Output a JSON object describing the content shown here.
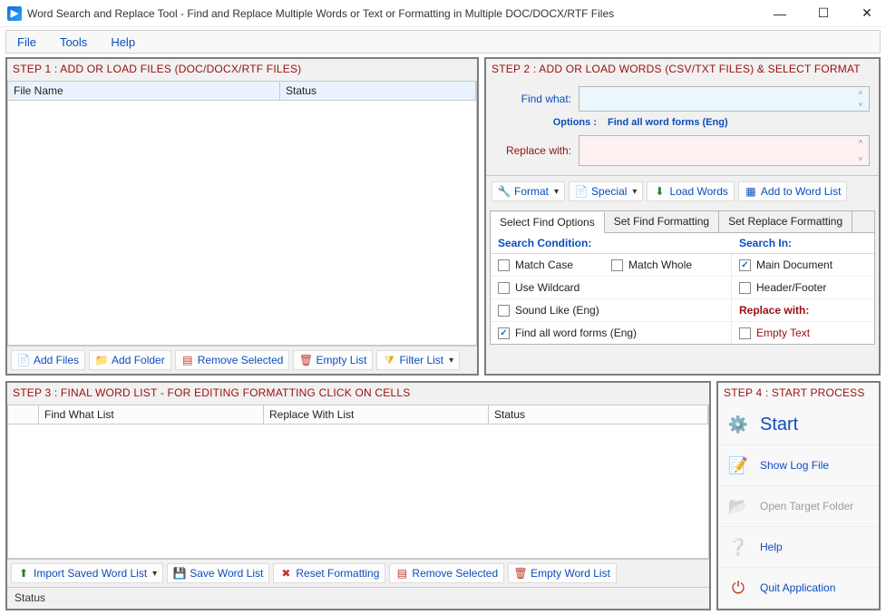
{
  "window": {
    "title": "Word Search and Replace Tool - Find and Replace Multiple Words or Text  or Formatting in Multiple DOC/DOCX/RTF Files"
  },
  "menu": {
    "file": "File",
    "tools": "Tools",
    "help": "Help"
  },
  "step1": {
    "title": "STEP 1 : ADD OR LOAD FILES (DOC/DOCX/RTF FILES)",
    "col_filename": "File Name",
    "col_status": "Status",
    "btn_add_files": "Add Files",
    "btn_add_folder": "Add Folder",
    "btn_remove_selected": "Remove Selected",
    "btn_empty_list": "Empty List",
    "btn_filter_list": "Filter List"
  },
  "step2": {
    "title": "STEP 2 : ADD OR LOAD WORDS (CSV/TXT FILES) & SELECT FORMAT",
    "find_what_label": "Find what:",
    "find_what_value": "",
    "options_label": "Options :",
    "options_value": "Find all word forms (Eng)",
    "replace_with_label": "Replace with:",
    "replace_with_value": "",
    "btn_format": "Format",
    "btn_special": "Special",
    "btn_load_words": "Load Words",
    "btn_add_to_word_list": "Add to Word List",
    "tabs": {
      "select_find": "Select Find Options",
      "set_find_fmt": "Set Find Formatting",
      "set_replace_fmt": "Set Replace Formatting"
    },
    "hdr_search_condition": "Search Condition:",
    "hdr_search_in": "Search In:",
    "opt_match_case": "Match Case",
    "opt_match_whole": "Match Whole",
    "opt_main_document": "Main Document",
    "opt_use_wildcard": "Use Wildcard",
    "opt_header_footer": "Header/Footer",
    "opt_sound_like": "Sound Like (Eng)",
    "hdr_replace_with": "Replace with:",
    "opt_find_all_word_forms": "Find all word forms (Eng)",
    "opt_empty_text": "Empty Text",
    "checked": {
      "match_case": false,
      "match_whole": false,
      "main_document": true,
      "use_wildcard": false,
      "header_footer": false,
      "sound_like": false,
      "find_all_word_forms": true,
      "empty_text": false
    }
  },
  "step3": {
    "title": "STEP 3 : FINAL WORD LIST - FOR EDITING FORMATTING CLICK ON CELLS",
    "col_find": "Find What List",
    "col_replace": "Replace With List",
    "col_status": "Status",
    "btn_import_saved": "Import Saved Word List",
    "btn_save_word_list": "Save Word List",
    "btn_reset_formatting": "Reset Formatting",
    "btn_remove_selected": "Remove Selected",
    "btn_empty_word_list": "Empty Word List",
    "status_text": "Status"
  },
  "step4": {
    "title": "STEP 4 : START PROCESS",
    "start": "Start",
    "show_log": "Show Log File",
    "open_target": "Open Target Folder",
    "help": "Help",
    "quit": "Quit Application"
  }
}
